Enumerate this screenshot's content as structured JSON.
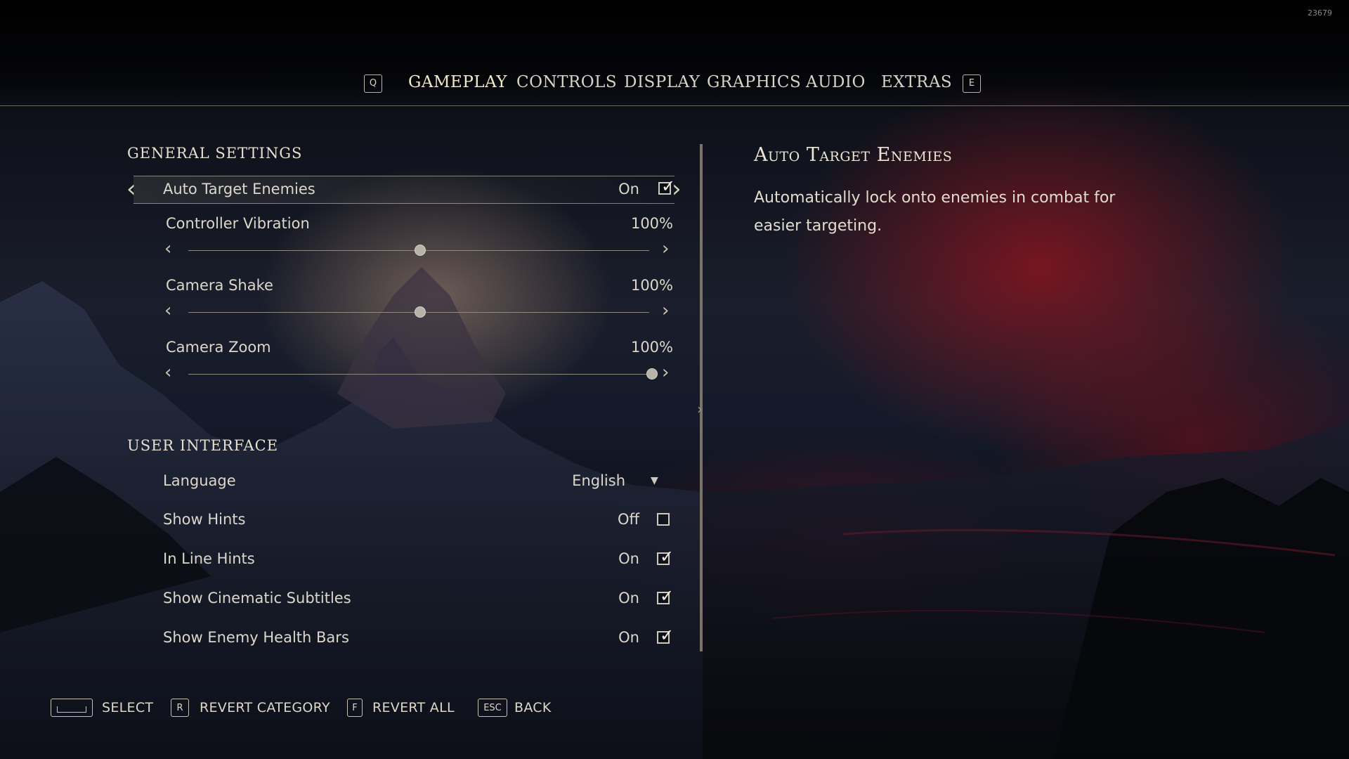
{
  "build_number": "23679",
  "nav": {
    "prev_key": "Q",
    "next_key": "E",
    "tabs": [
      {
        "label": "GAMEPLAY",
        "active": true
      },
      {
        "label": "CONTROLS",
        "active": false
      },
      {
        "label": "DISPLAY",
        "active": false
      },
      {
        "label": "GRAPHICS",
        "active": false
      },
      {
        "label": "AUDIO",
        "active": false
      },
      {
        "label": "EXTRAS",
        "active": false
      }
    ]
  },
  "general_settings": {
    "title": "GENERAL SETTINGS",
    "auto_target": {
      "label": "Auto Target Enemies",
      "value": "On",
      "checked": true
    },
    "controller_vibration": {
      "label": "Controller Vibration",
      "value": "100%",
      "level": 0.5
    },
    "camera_shake": {
      "label": "Camera Shake",
      "value": "100%",
      "level": 0.5
    },
    "camera_zoom": {
      "label": "Camera Zoom",
      "value": "100%",
      "level": 1.0
    }
  },
  "user_interface": {
    "title": "USER INTERFACE",
    "language": {
      "label": "Language",
      "value": "English"
    },
    "show_hints": {
      "label": "Show Hints",
      "value": "Off",
      "checked": false
    },
    "in_line_hints": {
      "label": "In Line Hints",
      "value": "On",
      "checked": true
    },
    "cinematic_subtitles": {
      "label": "Show Cinematic Subtitles",
      "value": "On",
      "checked": true
    },
    "enemy_health_bars": {
      "label": "Show Enemy Health Bars",
      "value": "On",
      "checked": true
    }
  },
  "description": {
    "title": "Auto Target Enemies",
    "text": "Automatically lock onto enemies in combat for easier targeting."
  },
  "footer": {
    "select_label": "SELECT",
    "revert_category_key": "R",
    "revert_category_label": "REVERT CATEGORY",
    "revert_all_key": "F",
    "revert_all_label": "REVERT ALL",
    "back_key": "ESC",
    "back_label": "BACK"
  },
  "colors": {
    "accent_red": "#96141e",
    "text": "#e8e2d6"
  }
}
